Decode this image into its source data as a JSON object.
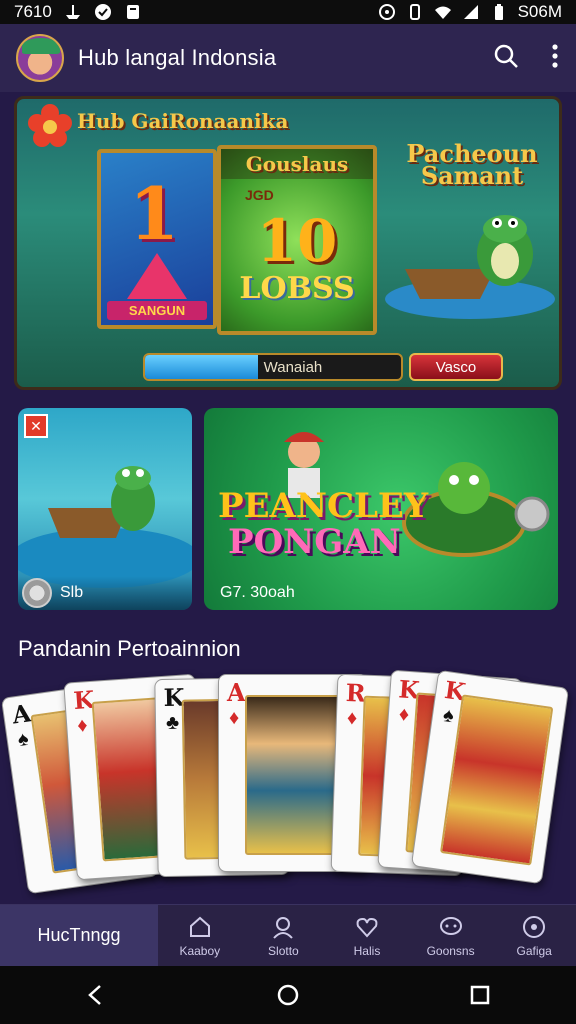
{
  "status_bar": {
    "time": "7610",
    "right_text": "S06M"
  },
  "app_bar": {
    "title": "Hub langal Indonsia"
  },
  "hero": {
    "title": "Hub GaiRonaanika",
    "left_panel_big": "1",
    "left_panel_sub": "SANGUN",
    "mid_panel_title": "Gouslaus",
    "mid_panel_small": "JGD",
    "mid_panel_number": "10",
    "mid_panel_bottom": "LOBSS",
    "right_panel_title_line1": "Pacheoun",
    "right_panel_title_line2": "Samant",
    "progress_text": "Wanaiah",
    "progress": 0.44,
    "button_label": "Vasco"
  },
  "game_cards": [
    {
      "footer": "Slb",
      "badge": "✕"
    },
    {
      "title_line1": "PEANCLEY",
      "title_line2": "PONGAN",
      "footer": "G7. 30oah"
    }
  ],
  "section": {
    "title": "Pandanin Pertoainnion"
  },
  "playing_cards": [
    {
      "rank": "A",
      "suit": "♠",
      "color": "#111111"
    },
    {
      "rank": "K",
      "suit": "♦",
      "color": "#d42a2a"
    },
    {
      "rank": "K",
      "suit": "♣",
      "color": "#111111"
    },
    {
      "rank": "A",
      "suit": "♦",
      "color": "#d42a2a"
    },
    {
      "rank": "R",
      "suit": "♦",
      "color": "#d42a2a"
    },
    {
      "rank": "K",
      "suit": "♦",
      "color": "#d42a2a"
    },
    {
      "rank": "K",
      "suit": "♠",
      "color": "#d42a2a"
    }
  ],
  "bottom_nav": {
    "active": "HucTnngg",
    "items": [
      {
        "label": "Kaaboy",
        "icon": "home-icon"
      },
      {
        "label": "Slotto",
        "icon": "person-icon"
      },
      {
        "label": "Halis",
        "icon": "heart-icon"
      },
      {
        "label": "Goonsns",
        "icon": "chat-icon"
      },
      {
        "label": "Gafiga",
        "icon": "gamepad-icon"
      }
    ]
  },
  "colors": {
    "background": "#241a47",
    "appbar": "#2e2550",
    "nav_active": "#3c3566",
    "accent_gold": "#f6c84a"
  }
}
